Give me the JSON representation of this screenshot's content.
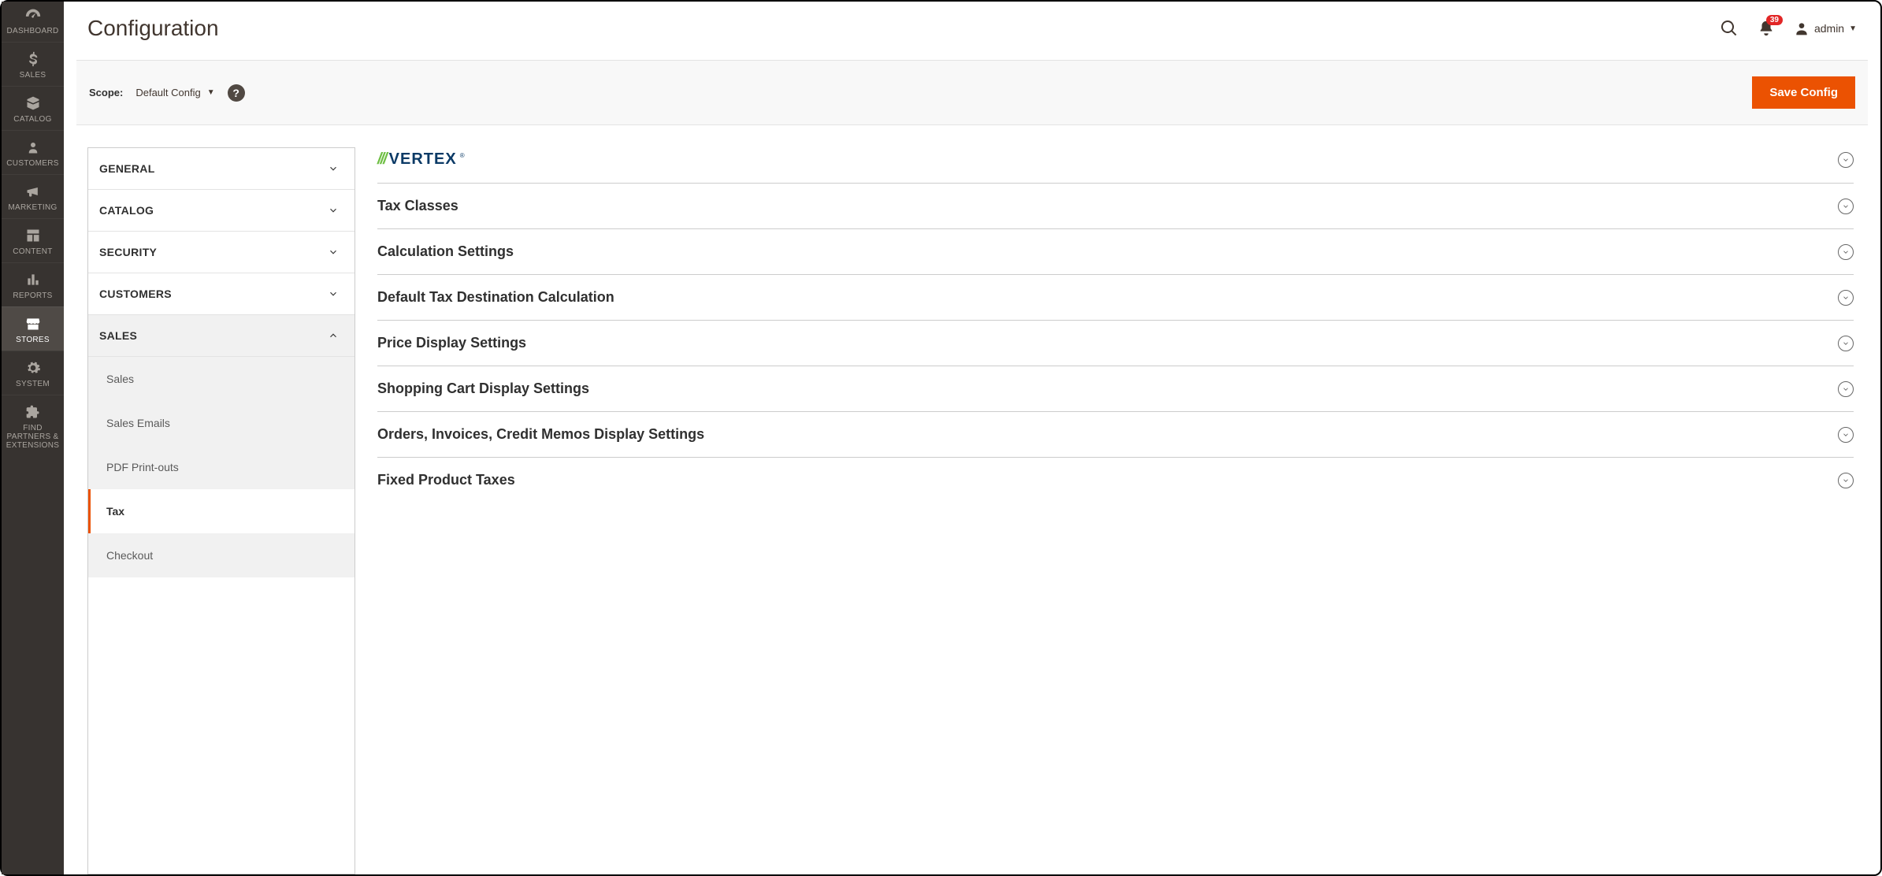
{
  "nav": {
    "items": [
      {
        "key": "dashboard",
        "label": "DASHBOARD"
      },
      {
        "key": "sales",
        "label": "SALES"
      },
      {
        "key": "catalog",
        "label": "CATALOG"
      },
      {
        "key": "customers",
        "label": "CUSTOMERS"
      },
      {
        "key": "marketing",
        "label": "MARKETING"
      },
      {
        "key": "content",
        "label": "CONTENT"
      },
      {
        "key": "reports",
        "label": "REPORTS"
      },
      {
        "key": "stores",
        "label": "STORES",
        "active": true
      },
      {
        "key": "system",
        "label": "SYSTEM"
      },
      {
        "key": "find-partners",
        "label": "FIND PARTNERS & EXTENSIONS"
      }
    ]
  },
  "header": {
    "title": "Configuration",
    "notification_count": "39",
    "user_label": "admin"
  },
  "scope": {
    "label": "Scope:",
    "value": "Default Config",
    "save_label": "Save Config"
  },
  "config_tabs": [
    {
      "label": "GENERAL",
      "state": "collapsed"
    },
    {
      "label": "CATALOG",
      "state": "collapsed"
    },
    {
      "label": "SECURITY",
      "state": "collapsed"
    },
    {
      "label": "CUSTOMERS",
      "state": "collapsed"
    },
    {
      "label": "SALES",
      "state": "expanded",
      "items": [
        {
          "label": "Sales"
        },
        {
          "label": "Sales Emails"
        },
        {
          "label": "PDF Print-outs"
        },
        {
          "label": "Tax",
          "active": true
        },
        {
          "label": "Checkout"
        }
      ]
    }
  ],
  "sections": [
    {
      "label_type": "logo",
      "brand_mark": "///",
      "brand_name": "VERTEX"
    },
    {
      "label": "Tax Classes"
    },
    {
      "label": "Calculation Settings"
    },
    {
      "label": "Default Tax Destination Calculation"
    },
    {
      "label": "Price Display Settings"
    },
    {
      "label": "Shopping Cart Display Settings"
    },
    {
      "label": "Orders, Invoices, Credit Memos Display Settings"
    },
    {
      "label": "Fixed Product Taxes"
    }
  ]
}
